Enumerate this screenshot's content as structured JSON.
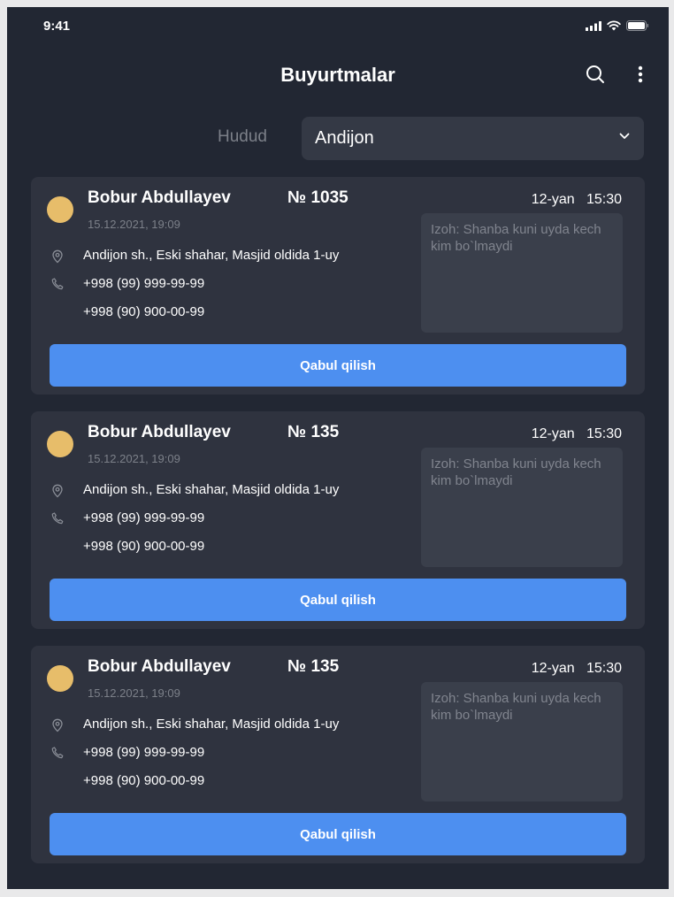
{
  "status_bar": {
    "time": "9:41"
  },
  "header": {
    "title": "Buyurtmalar",
    "search_icon": "search-icon",
    "more_icon": "more-vertical-icon"
  },
  "filter": {
    "label": "Hudud",
    "selected": "Andijon"
  },
  "orders": [
    {
      "customer": "Bobur Abdullayev",
      "number": "№ 1035",
      "date": "12-yan",
      "time": "15:30",
      "created": "15.12.2021, 19:09",
      "address": "Andijon sh., Eski shahar, Masjid oldida 1-uy",
      "phone1": "+998 (99) 999-99-99",
      "phone2": "+998 (90) 900-00-99",
      "note": "Izoh: Shanba kuni uyda kech kim bo`lmaydi",
      "button": "Qabul qilish"
    },
    {
      "customer": "Bobur Abdullayev",
      "number": "№ 135",
      "date": "12-yan",
      "time": "15:30",
      "created": "15.12.2021, 19:09",
      "address": "Andijon sh., Eski shahar, Masjid oldida 1-uy",
      "phone1": "+998 (99) 999-99-99",
      "phone2": "+998 (90) 900-00-99",
      "note": "Izoh: Shanba kuni uyda kech kim bo`lmaydi",
      "button": "Qabul qilish"
    },
    {
      "customer": "Bobur Abdullayev",
      "number": "№ 135",
      "date": "12-yan",
      "time": "15:30",
      "created": "15.12.2021, 19:09",
      "address": "Andijon sh., Eski shahar, Masjid oldida 1-uy",
      "phone1": "+998 (99) 999-99-99",
      "phone2": "+998 (90) 900-00-99",
      "note": "Izoh: Shanba kuni uyda kech kim bo`lmaydi",
      "button": "Qabul qilish"
    }
  ],
  "colors": {
    "background": "#222733",
    "card": "#2f333f",
    "accent": "#4d8ff0",
    "avatar": "#e7bd6a"
  }
}
